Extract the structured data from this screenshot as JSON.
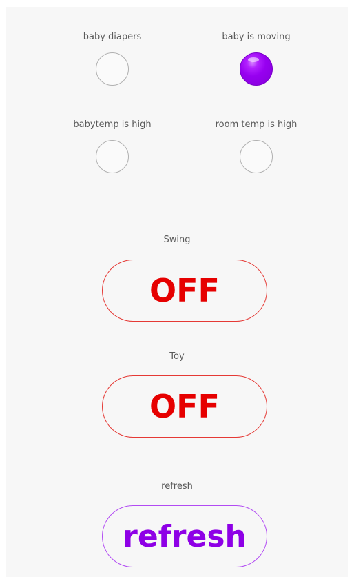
{
  "indicators": [
    {
      "label": "baby diapers",
      "state": "off"
    },
    {
      "label": "baby is moving",
      "state": "on"
    },
    {
      "label": "babytemp is high",
      "state": "off"
    },
    {
      "label": "room temp is high",
      "state": "off"
    }
  ],
  "controls": {
    "swing": {
      "label": "Swing",
      "button_text": "OFF"
    },
    "toy": {
      "label": "Toy",
      "button_text": "OFF"
    },
    "refresh": {
      "label": "refresh",
      "button_text": "refresh"
    }
  },
  "colors": {
    "active_indicator": "#9700f0",
    "off_button": "#e60000",
    "refresh_button": "#8e00e6"
  }
}
